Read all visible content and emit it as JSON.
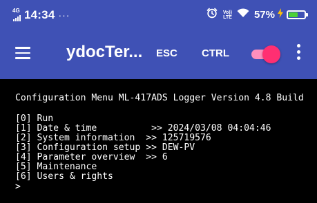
{
  "status_bar": {
    "network": "4G",
    "time": "14:34",
    "dots": "···",
    "volte_top": "Vo))",
    "volte_bottom": "LTE",
    "battery_percent": "57%",
    "battery_level": 0.57,
    "icons": [
      "signal-icon",
      "alarm-icon",
      "volte-icon",
      "wifi-icon",
      "charging-bolt-icon",
      "battery-icon"
    ],
    "colors": {
      "background": "#3f51b5",
      "battery_fill": "#4cd137",
      "bolt": "#ffc107"
    }
  },
  "app_bar": {
    "title": "ydocTer...",
    "esc_label": "ESC",
    "ctrl_label": "CTRL",
    "toggle_on": true,
    "icons": [
      "menu-icon",
      "overflow-menu-icon"
    ],
    "colors": {
      "background": "#3f51b5",
      "toggle_thumb": "#ff2f72",
      "toggle_track": "#ff8fbd"
    }
  },
  "terminal": {
    "lines": [
      "Configuration Menu ML-417ADS Logger Version 4.8 Build",
      "",
      "[0] Run",
      "[1] Date & time          >> 2024/03/08 04:04:46",
      "[2] System information  >> 125719576",
      "[3] Configuration setup >> DEW-PV",
      "[4] Parameter overview  >> 6",
      "[5] Maintenance",
      "[6] Users & rights",
      ">"
    ]
  }
}
